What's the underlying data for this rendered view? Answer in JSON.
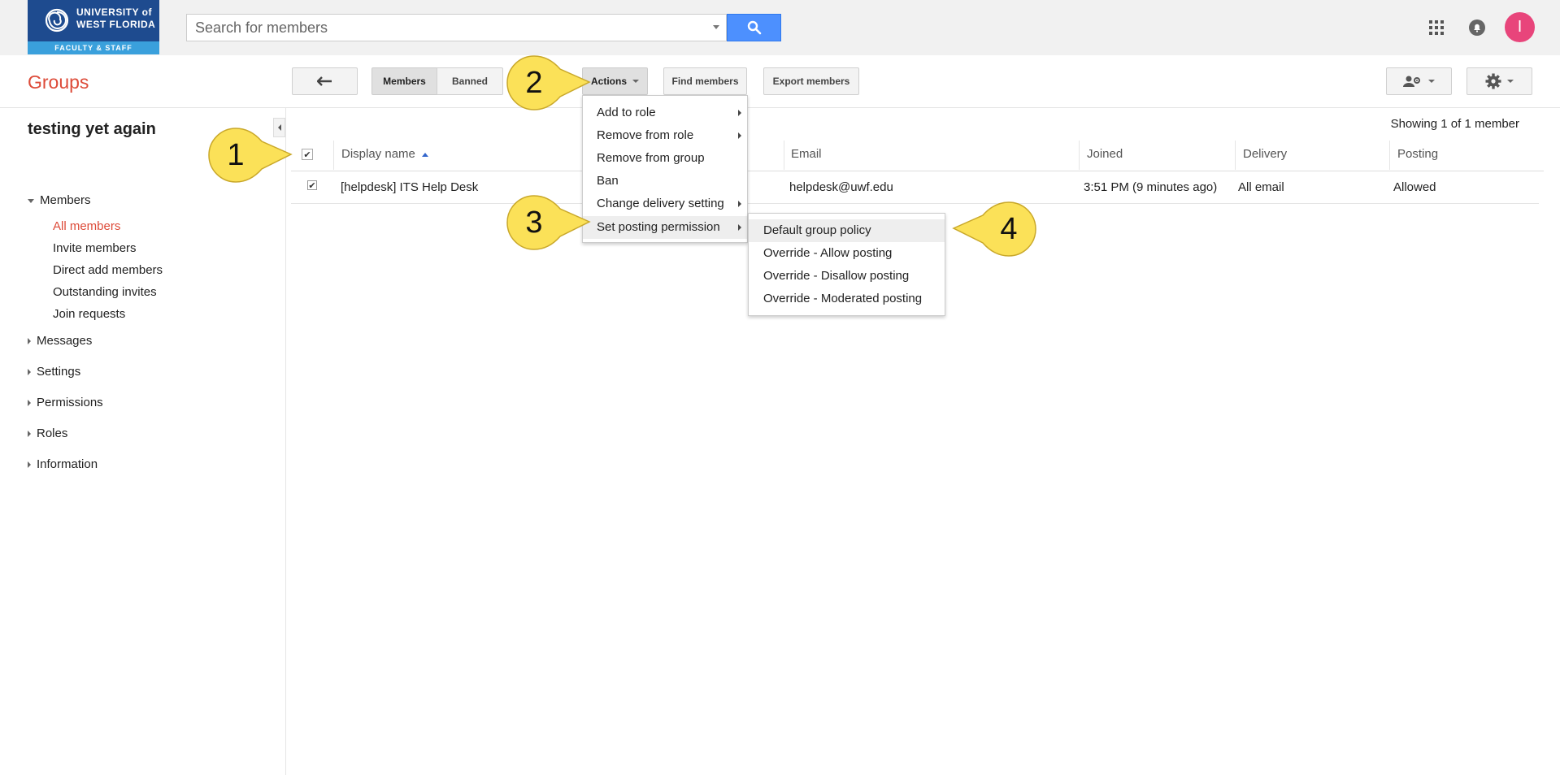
{
  "brand": {
    "university_line1": "UNIVERSITY of",
    "university_line2": "WEST FLORIDA",
    "band": "FACULTY & STAFF"
  },
  "search": {
    "placeholder": "Search for members"
  },
  "top_icons": [
    "apps-grid-icon",
    "notifications-icon"
  ],
  "avatar": {
    "letter": "I",
    "color": "#e8457b"
  },
  "header": {
    "title": "Groups",
    "back_icon": "arrow-back-icon",
    "tabs": [
      "Members",
      "Banned"
    ],
    "actions_label": "Actions",
    "find_members_label": "Find members",
    "export_members_label": "Export members"
  },
  "sidebar": {
    "group_name": "testing yet again",
    "members_label": "Members",
    "member_items": [
      "All members",
      "Invite members",
      "Direct add members",
      "Outstanding invites",
      "Join requests"
    ],
    "sections": [
      "Messages",
      "Settings",
      "Permissions",
      "Roles",
      "Information"
    ]
  },
  "table": {
    "showing": "Showing 1 of 1 member",
    "headers": {
      "display_name": "Display name",
      "email": "Email",
      "joined": "Joined",
      "delivery": "Delivery",
      "posting": "Posting"
    },
    "rows": [
      {
        "display_name": "[helpdesk] ITS Help Desk",
        "email": "helpdesk@uwf.edu",
        "joined": "3:51 PM (9 minutes ago)",
        "delivery": "All email",
        "posting": "Allowed",
        "checked": true
      }
    ]
  },
  "actions_menu": {
    "items": [
      "Add to role",
      "Remove from role",
      "Remove from group",
      "Ban",
      "Change delivery setting",
      "Set posting permission"
    ]
  },
  "posting_submenu": {
    "items": [
      "Default group policy",
      "Override - Allow posting",
      "Override - Disallow posting",
      "Override - Moderated posting"
    ]
  },
  "callouts": [
    "1",
    "2",
    "3",
    "4"
  ],
  "colors": {
    "accent": "#dd4b39",
    "search_button": "#4d90fe",
    "callout": "#fbe158"
  }
}
